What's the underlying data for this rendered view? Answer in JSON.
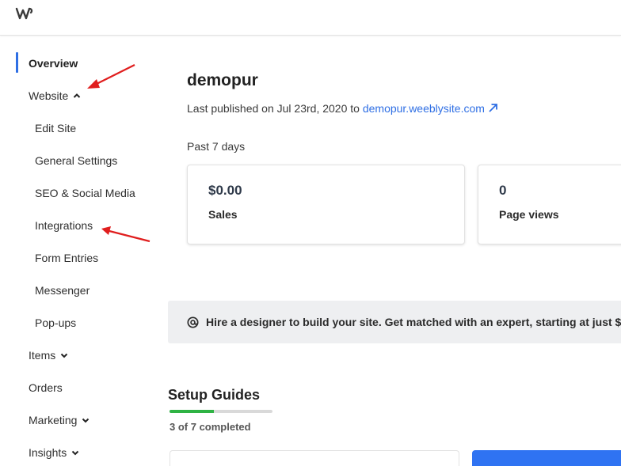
{
  "brand": {
    "logo_icon": "weebly-w-logo-icon"
  },
  "sidebar": {
    "items": [
      {
        "label": "Overview",
        "active": true
      },
      {
        "label": "Website",
        "expanded": true
      },
      {
        "label": "Edit Site"
      },
      {
        "label": "General Settings"
      },
      {
        "label": "SEO & Social Media"
      },
      {
        "label": "Integrations"
      },
      {
        "label": "Form Entries"
      },
      {
        "label": "Messenger"
      },
      {
        "label": "Pop-ups"
      },
      {
        "label": "Items",
        "expanded": false
      },
      {
        "label": "Orders"
      },
      {
        "label": "Marketing",
        "expanded": false
      },
      {
        "label": "Insights",
        "expanded": false
      }
    ],
    "accent_color": "#2f6fe4"
  },
  "site": {
    "name": "demopur",
    "published_prefix": "Last published on Jul 23rd, 2020 to",
    "url_label": "demopur.weeblysite.com",
    "link_icon": "external-link-arrow-icon"
  },
  "stats": {
    "period": "Past 7 days",
    "cards": [
      {
        "value": "$0.00",
        "label": "Sales"
      },
      {
        "value": "0",
        "label": "Page views"
      }
    ]
  },
  "banner": {
    "icon": "at-sign-icon",
    "text": "Hire a designer to build your site. Get matched with an expert, starting at just $"
  },
  "setup_guides": {
    "title": "Setup Guides",
    "progress_text": "3 of 7 completed",
    "completed": 3,
    "total": 7,
    "progress_color": "#2fb344"
  },
  "annotations": {
    "arrow_color": "#e01e1e"
  }
}
